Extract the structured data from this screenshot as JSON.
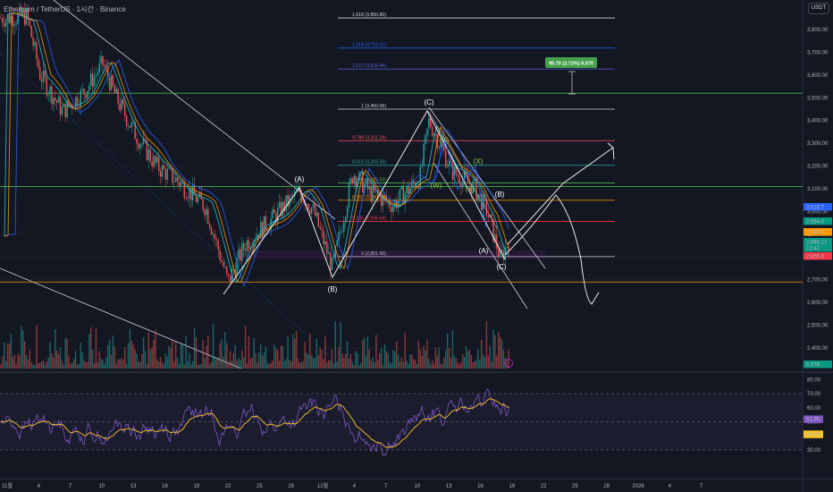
{
  "header": {
    "symbol": "Ethereum / TetherUS · 1시간 · Binance",
    "currency": "USDT"
  },
  "colors": {
    "background": "#131722",
    "up": "#26a69a",
    "down": "#ef5350",
    "fib_line": "#d1d4dc",
    "rsi_line": "#7e57c2",
    "rsi_ma": "#f7c525",
    "pattern": "#ffffff"
  },
  "chart_data": [
    {
      "type": "candlestick",
      "title": "",
      "yticks": [
        "2,400.00",
        "2,500.00",
        "2,600.00",
        "2,700.00",
        "2,800.00",
        "2,900.00",
        "3,000.00",
        "3,100.00",
        "3,200.00",
        "3,300.00",
        "3,400.00",
        "3,500.00",
        "3,600.00",
        "3,700.00",
        "3,800.00"
      ],
      "ylim": [
        2350,
        3900
      ],
      "xticks": [
        "11월",
        "4",
        "7",
        "10",
        "13",
        "16",
        "19",
        "22",
        "25",
        "28",
        "12월",
        "4",
        "7",
        "10",
        "13",
        "16",
        "19",
        "22",
        "25",
        "28",
        "2026",
        "4",
        "7"
      ],
      "price_tags": [
        {
          "label": "3,018.7",
          "color": "#2962ff",
          "value": 3018.7
        },
        {
          "label": "2,954.0",
          "color": "#089981",
          "value": 2954.0
        },
        {
          "label": "2,894.6",
          "color": "#ff9800",
          "value": 2894.6
        },
        {
          "label": "2,869.17",
          "color": "#089981",
          "value": 2869.17
        },
        {
          "label": "12:42",
          "color": "#089981",
          "value": 2855
        },
        {
          "label": "2,855.5",
          "color": "#f23645",
          "value": 2838
        }
      ],
      "fib_levels": [
        {
          "ratio": "0",
          "label": "0 (2,801.60)",
          "value": 2801.6,
          "color": "#d1d4dc"
        },
        {
          "ratio": "0.236",
          "label": "0.236 (2,956.64)",
          "value": 2956.64,
          "color": "#f23645"
        },
        {
          "ratio": "0.382",
          "label": "0.382 (3,049.35)",
          "value": 3049.35,
          "color": "#ff9800"
        },
        {
          "ratio": "0.5",
          "label": "0.5 (3,125.83)",
          "value": 3125.83,
          "color": "#4caf50"
        },
        {
          "ratio": "0.618",
          "label": "0.618 (3,203.35)",
          "value": 3203.35,
          "color": "#26a69a"
        },
        {
          "ratio": "0.786",
          "label": "0.786 (3,311.29)",
          "value": 3311.29,
          "color": "#f7525f"
        },
        {
          "ratio": "1",
          "label": "1 (3,450.06)",
          "value": 3450.06,
          "color": "#d1d4dc"
        },
        {
          "ratio": "1.272",
          "label": "1.272 (3,626.44)",
          "value": 3626.44,
          "color": "#5b5fd8"
        },
        {
          "ratio": "1.414",
          "label": "1.414 (3,718.52)",
          "value": 3718.52,
          "color": "#2962ff"
        },
        {
          "ratio": "1.618",
          "label": "1.618 (3,850.80)",
          "value": 3850.8,
          "color": "#d1d4dc"
        }
      ],
      "horizontal_lines": [
        {
          "value": 3520,
          "color": "#4caf50"
        },
        {
          "value": 3110,
          "color": "#4caf50"
        },
        {
          "value": 2690,
          "color": "#ff9800"
        }
      ],
      "wave_labels": [
        "(A)",
        "(B)",
        "(C)",
        "(X)",
        "(W)",
        "(X)",
        "(Y)",
        "(A)",
        "(B)",
        "(C)"
      ],
      "measure_label": "95.70 (2.72%) 9,570",
      "volume_label": "5.97K"
    },
    {
      "type": "line",
      "title": "",
      "yticks": [
        "30.00",
        "40.00",
        "50.00",
        "60.00",
        "70.00",
        "80.00"
      ],
      "ylim": [
        22,
        88
      ],
      "bands": [
        70,
        50,
        30
      ],
      "last_values": [
        {
          "label": "51.95",
          "color": "#7e57c2",
          "value": 51.95
        },
        {
          "label": "41.25",
          "color": "#f7c525",
          "value": 41.25
        }
      ]
    }
  ]
}
